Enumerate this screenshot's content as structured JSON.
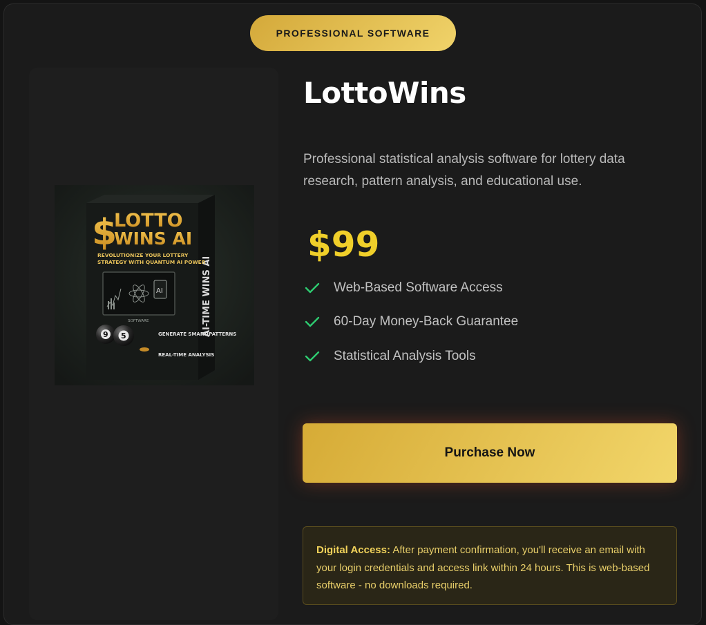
{
  "badge": {
    "label": "PROFESSIONAL SOFTWARE"
  },
  "product": {
    "name": "LottoWins",
    "description": "Professional statistical analysis software for lottery data research, pattern analysis, and educational use.",
    "price": "$99",
    "image": {
      "brand_line1": "LOTTO",
      "brand_line2": "WINS AI",
      "dollar": "$",
      "tagline1": "REVOLUTIONIZE YOUR LOTTERY",
      "tagline2": "STRATEGY WITH QUANTUM AI POWER",
      "spine_text": "AI-TIME WINS AI",
      "screen_chip": "AI",
      "software_label": "SOFTWARE",
      "ball1": "9",
      "ball2": "5",
      "bullet1": "GENERATE SMART PATTERNS",
      "bullet2": "REAL-TIME ANALYSIS"
    }
  },
  "features": [
    {
      "label": "Web-Based Software Access",
      "icon": "check-icon"
    },
    {
      "label": "60-Day Money-Back Guarantee",
      "icon": "check-icon"
    },
    {
      "label": "Statistical Analysis Tools",
      "icon": "check-icon"
    }
  ],
  "cta": {
    "label": "Purchase Now"
  },
  "notice": {
    "title": "Digital Access:",
    "text": "After payment confirmation, you'll receive an email with your login credentials and access link within 24 hours. This is web-based software - no downloads required."
  },
  "colors": {
    "accent_gold": "#E5BE4A",
    "price_yellow": "#F0CF2A",
    "check_green": "#2ECC71",
    "background": "#1B1B1B"
  }
}
